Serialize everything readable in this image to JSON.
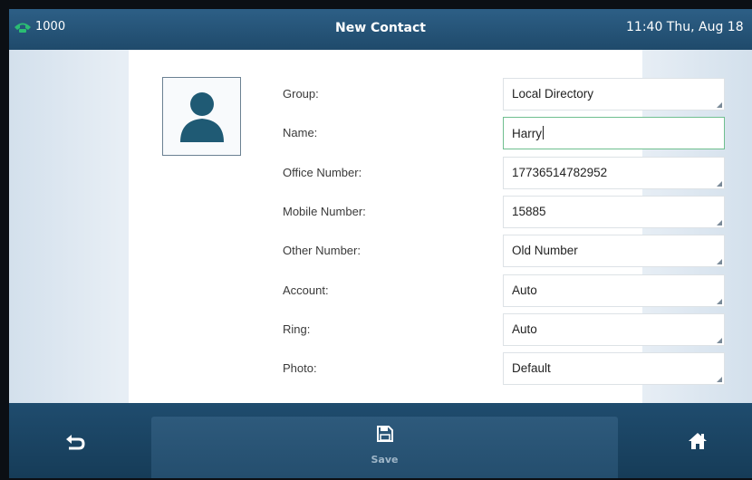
{
  "status_bar": {
    "line_label": "1000",
    "title": "New Contact",
    "clock": "11:40 Thu, Aug 18"
  },
  "form": {
    "fields": [
      {
        "label": "Group:",
        "value": "Local Directory"
      },
      {
        "label": "Name:",
        "value": "Harry"
      },
      {
        "label": "Office Number:",
        "value": "17736514782952"
      },
      {
        "label": "Mobile Number:",
        "value": "15885"
      },
      {
        "label": "Other Number:",
        "value": "Old Number"
      },
      {
        "label": "Account:",
        "value": "Auto"
      },
      {
        "label": "Ring:",
        "value": "Auto"
      },
      {
        "label": "Photo:",
        "value": "Default"
      }
    ]
  },
  "softkeys": {
    "back_icon": "back-arrow-icon",
    "save_label": "Save",
    "save_icon": "floppy-disk-icon",
    "home_icon": "home-icon"
  },
  "colors": {
    "header": "#1f4a6b",
    "line_status": "#2bbd73",
    "active_field_border": "#6fbf8f"
  }
}
